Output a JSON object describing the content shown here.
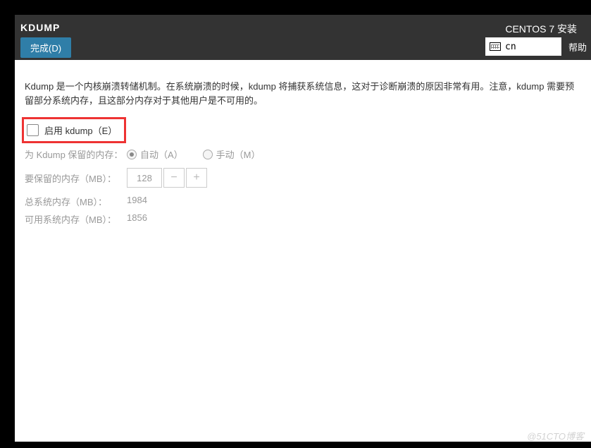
{
  "header": {
    "title": "KDUMP",
    "install_title": "CENTOS 7 安装",
    "done_button": "完成(D)",
    "keyboard_layout": "cn",
    "help": "帮助"
  },
  "description": "Kdump 是一个内核崩溃转储机制。在系统崩溃的时候，kdump 将捕获系统信息，这对于诊断崩溃的原因非常有用。注意，kdump 需要预留部分系统内存，且这部分内存对于其他用户是不可用的。",
  "enable": {
    "label": "启用 kdump（E）",
    "checked": false
  },
  "reserved": {
    "label": "为 Kdump 保留的内存：",
    "auto_label": "自动（A）",
    "manual_label": "手动（M）",
    "selected": "auto"
  },
  "to_reserve": {
    "label": "要保留的内存（MB）：",
    "value": "128"
  },
  "total_mem": {
    "label": "总系统内存（MB）：",
    "value": "1984"
  },
  "usable_mem": {
    "label": "可用系统内存（MB）：",
    "value": "1856"
  },
  "watermark": "@51CTO博客"
}
